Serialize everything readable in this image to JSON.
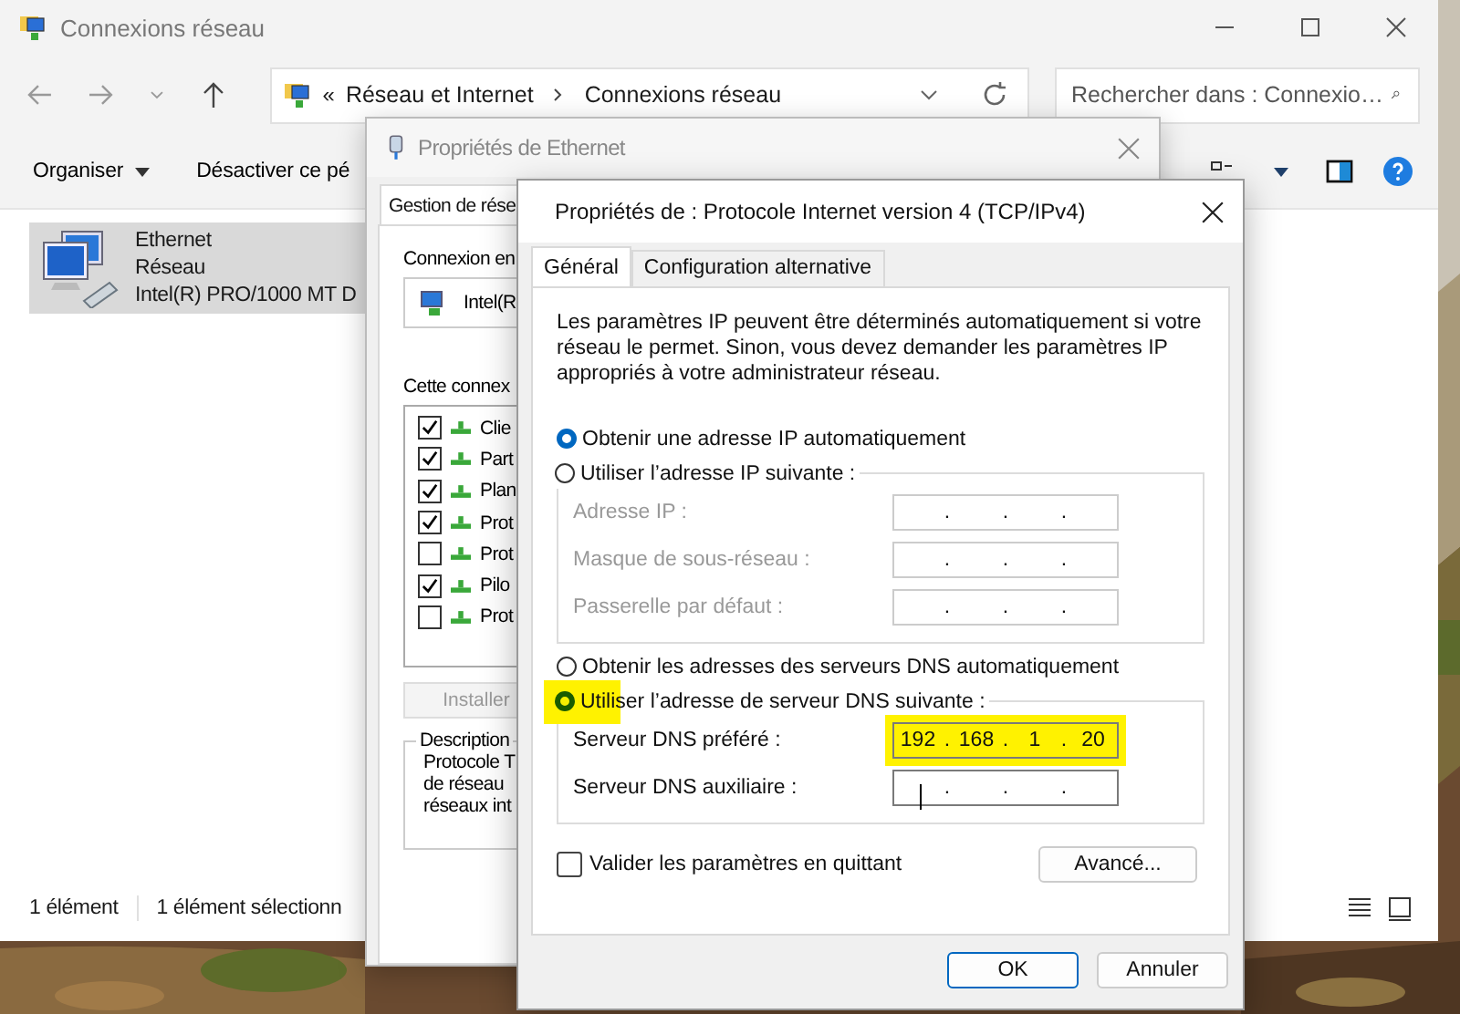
{
  "explorer": {
    "title": "Connexions réseau",
    "address": {
      "overflow": "«",
      "crumbs": [
        "Réseau et Internet",
        "Connexions réseau"
      ]
    },
    "search": {
      "placeholder": "Rechercher dans : Connexio…"
    },
    "commands": [
      "Organiser",
      "Désactiver ce pé"
    ],
    "items": [
      {
        "name": "Ethernet",
        "status": "Réseau",
        "adapter": "Intel(R) PRO/1000 MT D",
        "selected": true
      }
    ],
    "status_bar": [
      "1 élément",
      "1 élément sélectionn"
    ]
  },
  "ethernet_dialog": {
    "title": "Propriétés de Ethernet",
    "tabs": [
      {
        "label": "Gestion de rése",
        "selected": true
      }
    ],
    "connect_label": "Connexion en",
    "adapter": "Intel(R",
    "list_label": "Cette connex",
    "components": [
      {
        "label": "Clie",
        "checked": true
      },
      {
        "label": "Part",
        "checked": true
      },
      {
        "label": "Plan",
        "checked": true
      },
      {
        "label": "Prot",
        "checked": true
      },
      {
        "label": "Prot",
        "checked": false
      },
      {
        "label": "Pilo",
        "checked": true
      },
      {
        "label": "Prot",
        "checked": false
      }
    ],
    "install_button": {
      "label": "Installer",
      "disabled": true
    },
    "description_title": "Description",
    "description_lines": [
      "Protocole T",
      "de réseau",
      "réseaux int"
    ]
  },
  "ipv4_dialog": {
    "title": "Propriétés de : Protocole Internet version 4 (TCP/IPv4)",
    "tabs": [
      {
        "label": "Général",
        "selected": true
      },
      {
        "label": "Configuration alternative",
        "selected": false
      }
    ],
    "intro": "Les paramètres IP peuvent être déterminés automatiquement si votre réseau le permet. Sinon, vous devez demander les paramètres IP appropriés à votre administrateur réseau.",
    "ip_options": [
      {
        "label": "Obtenir une adresse IP automatiquement",
        "selected": true,
        "highlighted": false
      },
      {
        "label": "Utiliser l’adresse IP suivante :",
        "selected": false,
        "highlighted": false
      }
    ],
    "ip_fields": [
      {
        "label": "Adresse IP :",
        "disabled": true,
        "highlighted": false,
        "focused": false,
        "dots": [
          ".",
          ".",
          "."
        ]
      },
      {
        "label": "Masque de sous-réseau :",
        "disabled": true,
        "highlighted": false,
        "focused": false,
        "dots": [
          ".",
          ".",
          "."
        ]
      },
      {
        "label": "Passerelle par défaut :",
        "disabled": true,
        "highlighted": false,
        "focused": false,
        "dots": [
          ".",
          ".",
          "."
        ]
      }
    ],
    "dns_options": [
      {
        "label": "Obtenir les adresses des serveurs DNS automatiquement",
        "selected": false,
        "highlighted": false
      },
      {
        "label": "Utiliser l’adresse de serveur DNS suivante :",
        "selected": true,
        "highlighted": true
      }
    ],
    "dns_fields": [
      {
        "label": "Serveur DNS préféré :",
        "disabled": false,
        "highlighted": true,
        "focused": false,
        "octets": [
          "192",
          "168",
          "1",
          "20"
        ],
        "dots": [
          ".",
          ".",
          "."
        ]
      },
      {
        "label": "Serveur DNS auxiliaire :",
        "disabled": false,
        "highlighted": false,
        "focused": true,
        "dots": [
          ".",
          ".",
          "."
        ]
      }
    ],
    "validate": {
      "label": "Valider les paramètres en quittant",
      "checked": false
    },
    "advanced_button": "Avancé...",
    "buttons": [
      {
        "label": "OK",
        "default": true
      },
      {
        "label": "Annuler",
        "default": false
      }
    ]
  }
}
